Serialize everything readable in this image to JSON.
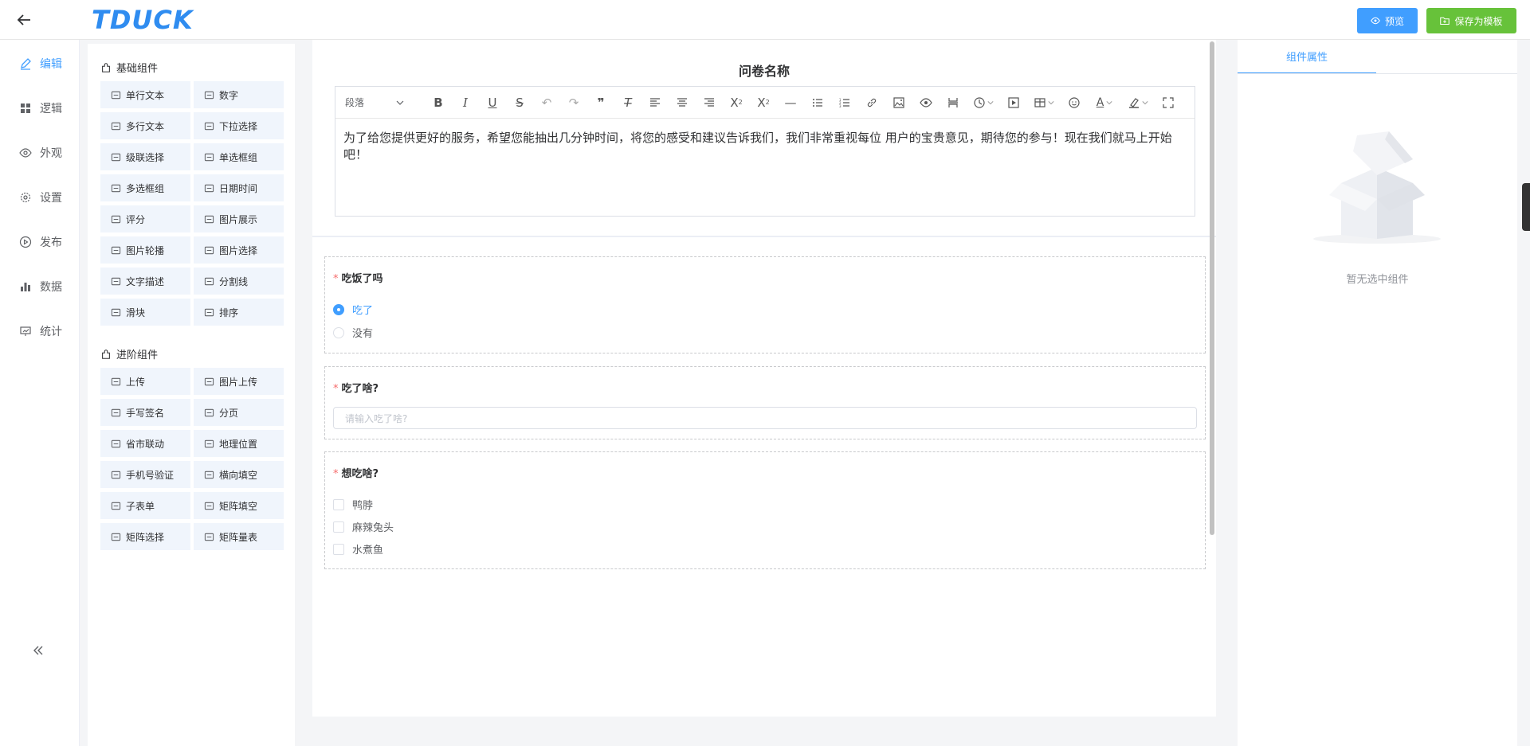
{
  "header": {
    "logo": "TDUCK",
    "preview_label": "预览",
    "save_template_label": "保存为模板"
  },
  "leftnav": {
    "items": [
      {
        "label": "编辑",
        "icon": "edit-icon",
        "active": true
      },
      {
        "label": "逻辑",
        "icon": "grid-icon",
        "active": false
      },
      {
        "label": "外观",
        "icon": "eye-icon",
        "active": false
      },
      {
        "label": "设置",
        "icon": "gear-icon",
        "active": false
      },
      {
        "label": "发布",
        "icon": "play-icon",
        "active": false
      },
      {
        "label": "数据",
        "icon": "bar-chart-icon",
        "active": false
      },
      {
        "label": "统计",
        "icon": "presentation-icon",
        "active": false
      }
    ]
  },
  "components": {
    "basic_title": "基础组件",
    "basic": [
      {
        "label": "单行文本",
        "icon": "input-icon"
      },
      {
        "label": "数字",
        "icon": "number-icon"
      },
      {
        "label": "多行文本",
        "icon": "textarea-icon"
      },
      {
        "label": "下拉选择",
        "icon": "select-icon"
      },
      {
        "label": "级联选择",
        "icon": "cascader-icon"
      },
      {
        "label": "单选框组",
        "icon": "radio-icon"
      },
      {
        "label": "多选框组",
        "icon": "checkbox-icon"
      },
      {
        "label": "日期时间",
        "icon": "calendar-icon"
      },
      {
        "label": "评分",
        "icon": "star-icon"
      },
      {
        "label": "图片展示",
        "icon": "image-icon"
      },
      {
        "label": "图片轮播",
        "icon": "carousel-icon"
      },
      {
        "label": "图片选择",
        "icon": "image-select-icon"
      },
      {
        "label": "文字描述",
        "icon": "text-icon"
      },
      {
        "label": "分割线",
        "icon": "divider-icon"
      },
      {
        "label": "滑块",
        "icon": "slider-icon"
      },
      {
        "label": "排序",
        "icon": "sort-icon"
      }
    ],
    "advanced_title": "进阶组件",
    "advanced": [
      {
        "label": "上传",
        "icon": "upload-icon"
      },
      {
        "label": "图片上传",
        "icon": "image-upload-icon"
      },
      {
        "label": "手写签名",
        "icon": "pen-icon"
      },
      {
        "label": "分页",
        "icon": "pagination-icon"
      },
      {
        "label": "省市联动",
        "icon": "city-icon"
      },
      {
        "label": "地理位置",
        "icon": "location-icon"
      },
      {
        "label": "手机号验证",
        "icon": "phone-icon"
      },
      {
        "label": "横向填空",
        "icon": "fill-blank-icon"
      },
      {
        "label": "子表单",
        "icon": "subform-icon"
      },
      {
        "label": "矩阵填空",
        "icon": "matrix-fill-icon"
      },
      {
        "label": "矩阵选择",
        "icon": "matrix-select-icon"
      },
      {
        "label": "矩阵量表",
        "icon": "matrix-scale-icon"
      }
    ]
  },
  "canvas": {
    "title": "问卷名称",
    "toolbar_paragraph": "段落",
    "description": "为了给您提供更好的服务，希望您能抽出几分钟时间，将您的感受和建议告诉我们，我们非常重视每位 用户的宝贵意见，期待您的参与！现在我们就马上开始吧！",
    "questions": [
      {
        "title": "吃饭了吗",
        "type": "radio",
        "options": [
          "吃了",
          "没有"
        ],
        "selected": "吃了"
      },
      {
        "title": "吃了啥?",
        "type": "input",
        "placeholder": "请输入吃了啥?"
      },
      {
        "title": "想吃啥?",
        "type": "checkbox",
        "options": [
          "鸭脖",
          "麻辣兔头",
          "水煮鱼"
        ]
      }
    ]
  },
  "right_panel": {
    "tab_label": "组件属性",
    "empty_text": "暂无选中组件"
  },
  "colors": {
    "primary": "#409eff",
    "success": "#67c23a",
    "required": "#f56c6c"
  }
}
